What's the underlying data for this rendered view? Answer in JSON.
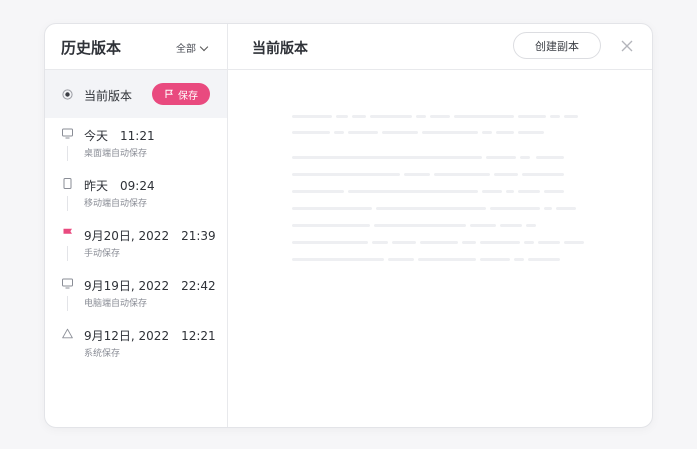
{
  "sidebar": {
    "title": "历史版本",
    "filter_label": "全部",
    "items": [
      {
        "icon": "current-dot-icon",
        "title": "当前版本",
        "time": "",
        "subtitle": ""
      },
      {
        "icon": "monitor-icon",
        "title": "今天",
        "time": "11:21",
        "subtitle": "桌面端自动保存"
      },
      {
        "icon": "mobile-icon",
        "title": "昨天",
        "time": "09:24",
        "subtitle": "移动端自动保存"
      },
      {
        "icon": "flag-icon",
        "title": "9月20日, 2022",
        "time": "21:39",
        "subtitle": "手动保存"
      },
      {
        "icon": "monitor-icon",
        "title": "9月19日, 2022",
        "time": "22:42",
        "subtitle": "电脑端自动保存"
      },
      {
        "icon": "warning-icon",
        "title": "9月12日, 2022",
        "time": "12:21",
        "subtitle": "系统保存"
      }
    ],
    "save_label": "保存"
  },
  "main": {
    "title": "当前版本",
    "copy_label": "创建副本"
  },
  "colors": {
    "accent": "#e94a7f",
    "border": "#e8e9ec",
    "skeleton": "#eeeff2"
  }
}
